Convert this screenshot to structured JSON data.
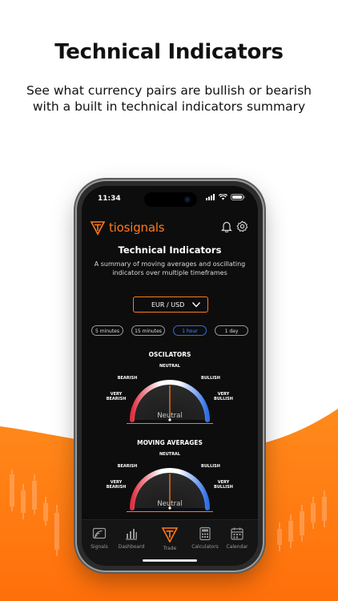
{
  "promo": {
    "headline": "Technical Indicators",
    "subline": "See what currency pairs are bullish or bearish with a built in technical indicators summary"
  },
  "status_bar": {
    "time": "11:34"
  },
  "app": {
    "brand": "tiosignals",
    "title": "Technical Indicators",
    "description": "A summary of moving averages and oscillating indicators over multiple timeframes",
    "pair_selector": {
      "value": "EUR / USD"
    },
    "timeframes": [
      {
        "label": "5 minutes",
        "active": false
      },
      {
        "label": "15 minutes",
        "active": false
      },
      {
        "label": "1 hour",
        "active": true
      },
      {
        "label": "1 day",
        "active": false
      }
    ],
    "gauge_labels": {
      "neutral": "NEUTRAL",
      "bearish": "BEARISH",
      "bullish": "BULLISH",
      "very_bearish_1": "VERY",
      "very_bearish_2": "BEARISH",
      "very_bullish_1": "VERY",
      "very_bullish_2": "BULLISH"
    },
    "oscillators": {
      "title": "OSCILATORS",
      "result": "Neutral",
      "needle_level": 0.5
    },
    "moving_averages": {
      "title": "MOVING AVERAGES",
      "result": "Neutral",
      "needle_level": 0.5
    }
  },
  "tabbar": {
    "items": [
      {
        "label": "Signals",
        "icon": "signals-icon"
      },
      {
        "label": "Dashboard",
        "icon": "dashboard-icon"
      },
      {
        "label": "Trade",
        "icon": "trade-icon"
      },
      {
        "label": "Calculators",
        "icon": "calculator-icon"
      },
      {
        "label": "Calendar",
        "icon": "calendar-icon"
      }
    ]
  },
  "colors": {
    "accent": "#ff7a1a",
    "bearish": "#e03040",
    "bullish": "#2f6fe6",
    "neutral": "#ffffff"
  }
}
